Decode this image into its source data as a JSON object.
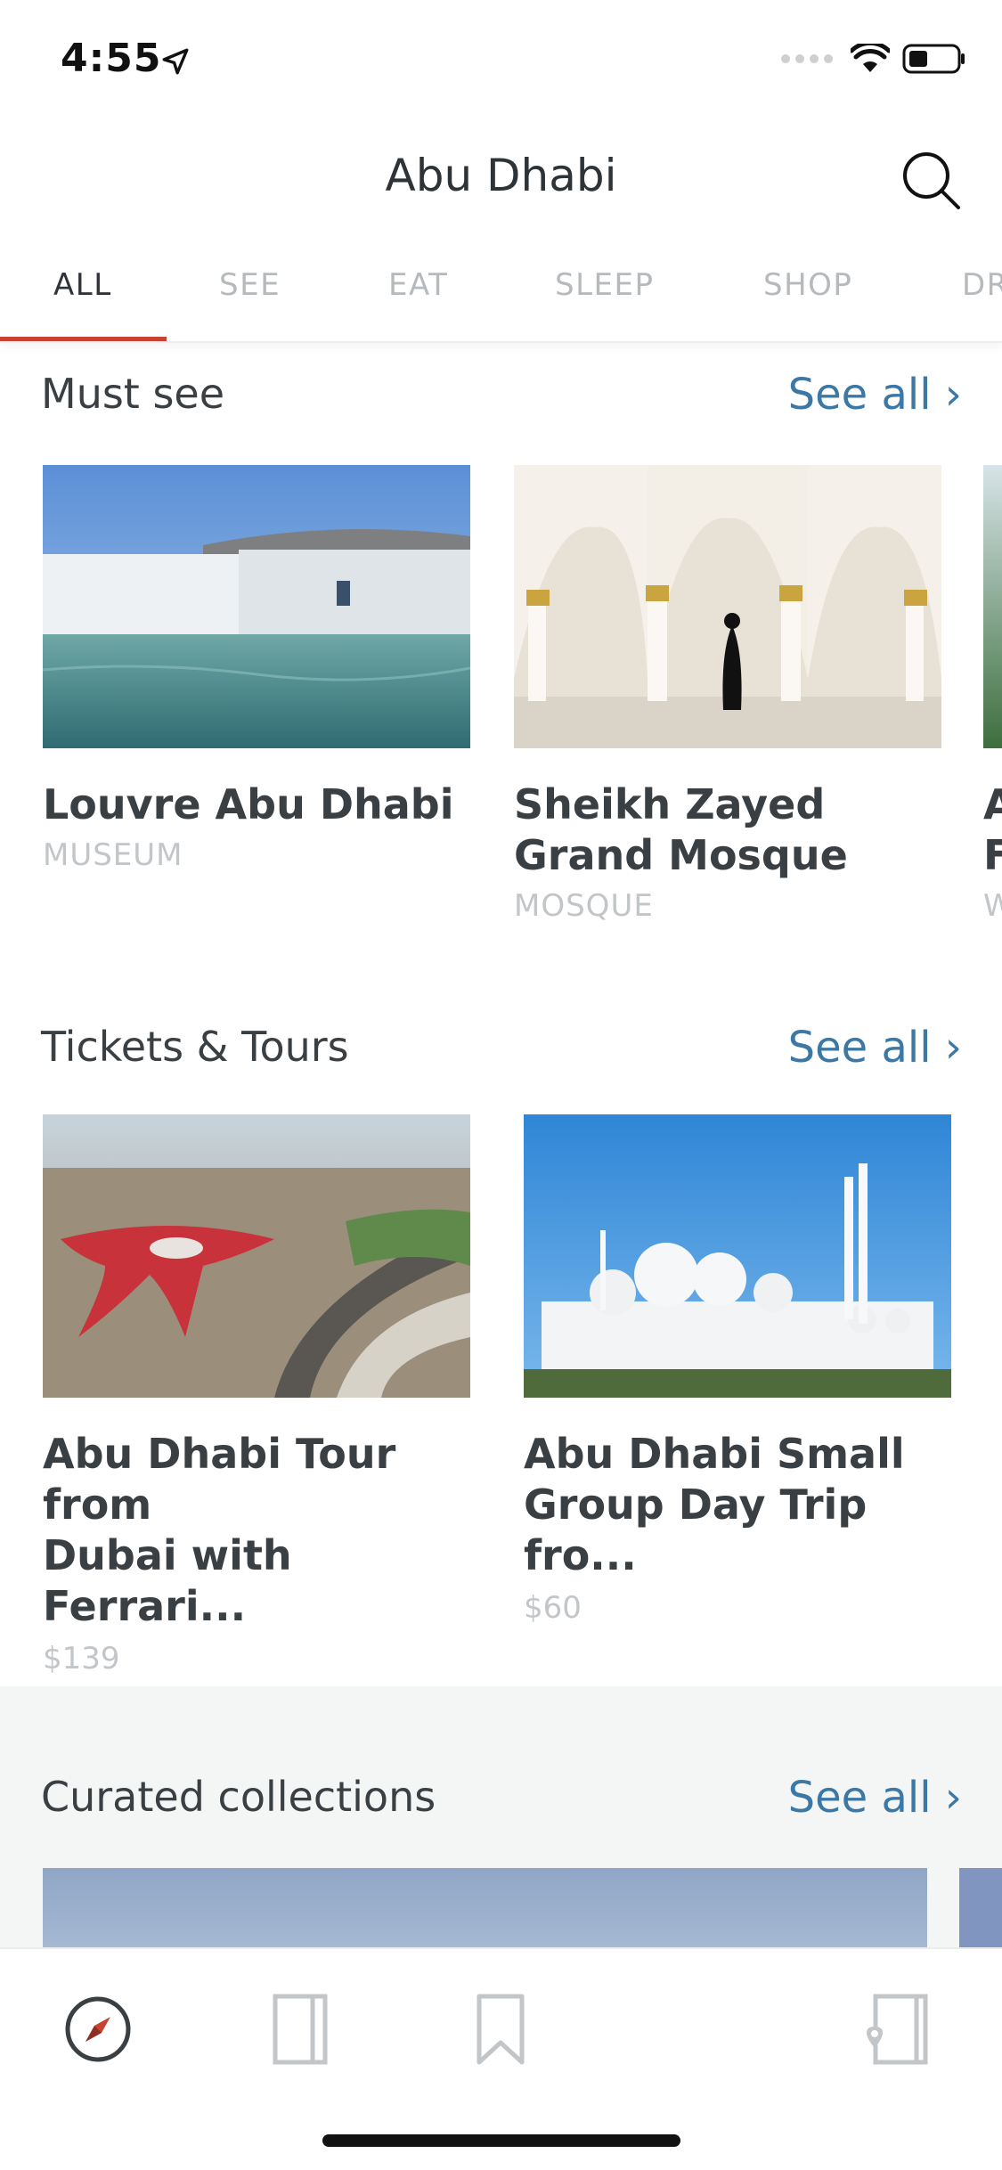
{
  "status": {
    "time": "4:55"
  },
  "header": {
    "title": "Abu Dhabi"
  },
  "tabs": [
    {
      "label": "ALL",
      "active": true
    },
    {
      "label": "SEE"
    },
    {
      "label": "EAT"
    },
    {
      "label": "SLEEP"
    },
    {
      "label": "SHOP"
    },
    {
      "label": "DR"
    }
  ],
  "must_see": {
    "title": "Must see",
    "see_all": "See all ›",
    "cards": [
      {
        "title_line1": "Louvre Abu Dhabi",
        "category": "MUSEUM"
      },
      {
        "title_line1": "Sheikh Zayed",
        "title_line2": "Grand Mosque",
        "category": "MOSQUE"
      },
      {
        "title_line1": "A",
        "title_line2": "F",
        "category": "W"
      }
    ]
  },
  "tickets": {
    "title": "Tickets & Tours",
    "see_all": "See all ›",
    "cards": [
      {
        "title_line1": "Abu Dhabi Tour from",
        "title_line2": "Dubai with Ferrari...",
        "price": "$139"
      },
      {
        "title_line1": "Abu Dhabi Small",
        "title_line2": "Group Day Trip fro...",
        "price": "$60"
      }
    ]
  },
  "curated": {
    "title": "Curated collections",
    "see_all": "See all ›"
  },
  "bottom_nav": [
    {
      "icon": "compass-icon"
    },
    {
      "icon": "guidebook-icon"
    },
    {
      "icon": "bookmark-icon"
    },
    {
      "icon": "map-pin-book-icon"
    }
  ],
  "colors": {
    "accent": "#c8432f",
    "link": "#3b78a6"
  }
}
